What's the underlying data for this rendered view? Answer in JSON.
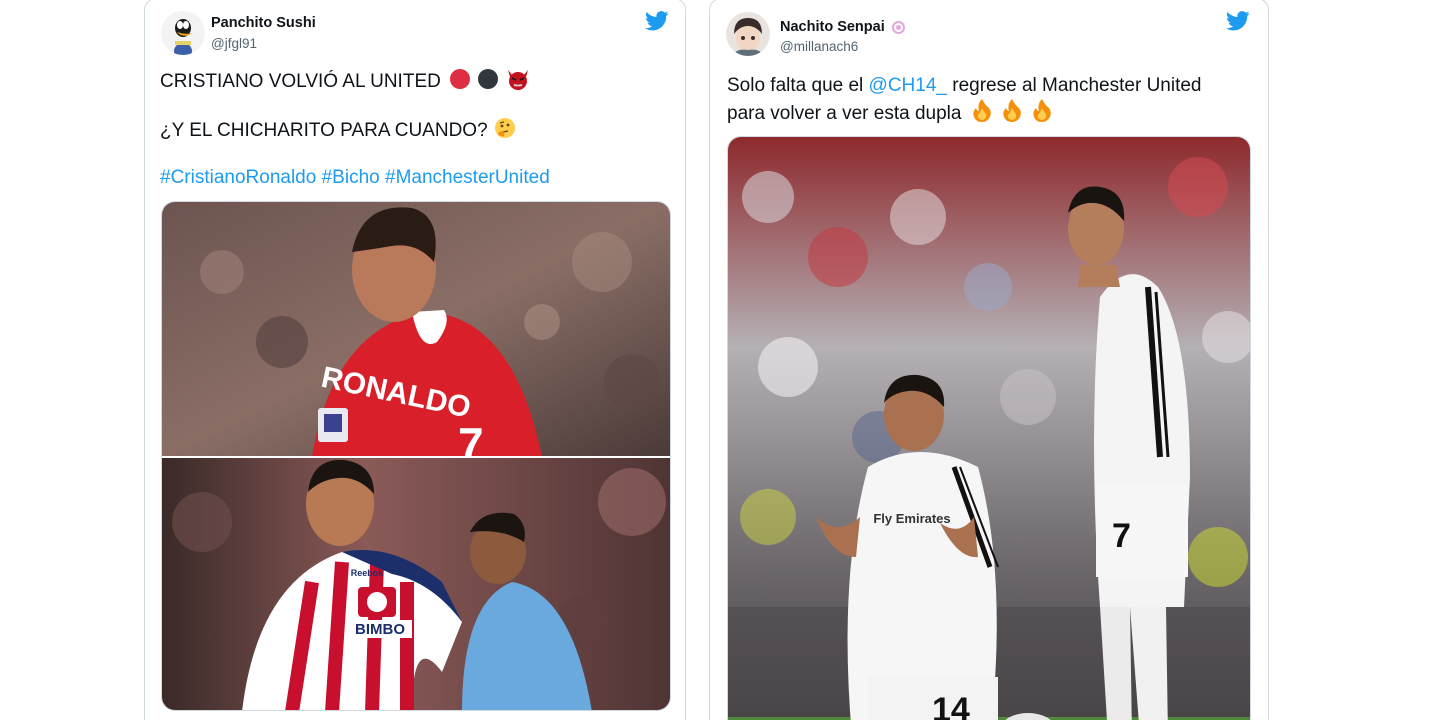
{
  "tweets": [
    {
      "display_name": "Panchito Sushi",
      "handle": "@jfgl91",
      "line1": "CRISTIANO VOLVIÓ AL UNITED",
      "line2": "¿Y EL CHICHARITO PARA CUANDO?",
      "hashtags": [
        "#CristianoRonaldo",
        "#Bicho",
        "#ManchesterUnited"
      ],
      "photo_top": {
        "jersey_name": "RONALDO",
        "jersey_number": "7"
      },
      "photo_bottom": {
        "sponsor": "BIMBO",
        "brand": "Reebok"
      }
    },
    {
      "display_name": "Nachito Senpai",
      "handle": "@millanach6",
      "text_before_mention": "Solo falta que el",
      "mention": "@CH14_",
      "text_after_mention": "regrese al Manchester United",
      "line2": "para volver a ver esta dupla",
      "photo": {
        "left_number": "14",
        "right_number": "7",
        "sponsor": "Fly Emirates"
      }
    }
  ],
  "colors": {
    "twitter_blue": "#1d9bf0",
    "united_red": "#d81f2a",
    "chivas_red": "#c8102e",
    "chivas_blue": "#1c2f6b"
  },
  "icons": [
    "twitter-bird-icon",
    "red-circle-emoji",
    "black-circle-emoji",
    "devil-emoji",
    "thinking-face-emoji",
    "fire-emoji"
  ]
}
